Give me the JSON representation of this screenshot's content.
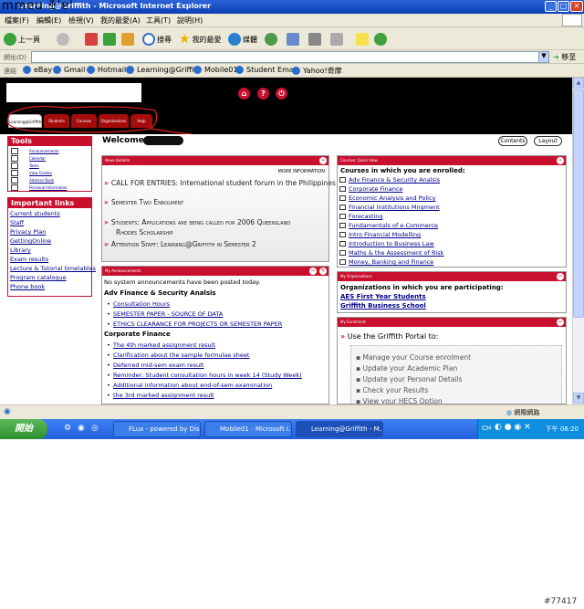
{
  "window": {
    "title": "Learning@Griffith - Microsoft Internet Explorer",
    "title_overwrite": "mmeu ꔀ'ɐ'"
  },
  "menu": [
    "檔案(F)",
    "編輯(E)",
    "檢視(V)",
    "我的最愛(A)",
    "工具(T)",
    "說明(H)"
  ],
  "toolbar": {
    "back": "上一頁",
    "search": "搜尋",
    "favorites": "我的最愛",
    "media": "媒體"
  },
  "address": {
    "label": "網址(D)",
    "value": "",
    "go": "移至"
  },
  "links": {
    "label": "連結",
    "items": [
      "eBay",
      "Gmail",
      "Hotmail",
      "Learning@Griffith",
      "Mobile01",
      "Student Email",
      "Yahoo!奇摩"
    ]
  },
  "site": {
    "nav_tabs": [
      "Learning@Griffith",
      "Students",
      "Courses",
      "Organisations",
      "Help"
    ],
    "tools": {
      "title": "Tools",
      "items": [
        "Announcements",
        "Calendar",
        "Tasks",
        "View Grades",
        "Address Book",
        "Personal Information"
      ]
    },
    "important": {
      "title": "Important links",
      "items": [
        "Current students",
        "Staff",
        "Privacy Plan",
        "GettingOnline",
        "Library",
        "Exam results",
        "Lecture & Tutorial timetables",
        "Program catalogue",
        "Phone book"
      ]
    },
    "welcome": "Welcome,",
    "contents_btn": "Contents",
    "layout_btn": "Layout",
    "news": {
      "title": "News Bulletin",
      "more": "MORE INFORMATION",
      "items": [
        "CALL FOR ENTRIES: International student forum in the Philippines",
        "Semester Two Enrolment",
        "Students: Applications are being called for 2006 Queensland",
        "Rhodes Scholarship",
        "Attention Staff: Learning@Griffith in Semester 2"
      ]
    },
    "announcements": {
      "title": "My Announcements",
      "none_text": "No system announcements have been posted today.",
      "sections": [
        {
          "name": "Adv Finance & Security Analsis",
          "items": [
            "Consultation Hours",
            "SEMESTER PAPER - SOURCE OF DATA",
            "ETHICS CLEARANCE FOR PROJECTS OR SEMESTER PAPER"
          ]
        },
        {
          "name": "Corporate Finance",
          "items": [
            "The 4th marked assignment result",
            "Clarification about the sample formulae sheet",
            "Deferred mid-sem exam result",
            "Reminder: Student consultation hours in week 14 (Study Week)",
            "Additional information about end-of-sem examination",
            "the 3rd marked assignment result"
          ]
        }
      ]
    },
    "quickview": {
      "title": "Courses: Quick View",
      "heading": "Courses in which you are enrolled:",
      "courses": [
        "Adv Finance & Security Analsis",
        "Corporate Finance",
        "Economic Analysis and Policy",
        "Financial Institutions Mngment",
        "Forecasting",
        "Fundamentals of e-Commerce",
        "Intro Financial Modelling",
        "Introduction to Business Law",
        "Maths & the Assessment of Risk",
        "Money, Banking and Finance"
      ]
    },
    "organisations": {
      "title": "My Organisations",
      "heading": "Organizations in which you are participating:",
      "items": [
        "AES First Year Students",
        "Griffith Business School"
      ]
    },
    "enrolment": {
      "title": "My Enrolment",
      "intro": "Use the Griffith Portal to:",
      "items": [
        "Manage your Course enrolment",
        "Update your Academic Plan",
        "Update your Personal Details",
        "Check your Results",
        "View your HECS Option"
      ]
    }
  },
  "statusbar": {
    "zone": "網際網路"
  },
  "taskbar": {
    "start": "開始",
    "tasks": [
      "FLux - powered by Dis...",
      "Mobile01 - Microsoft I...",
      "Learning@Griffith - M..."
    ],
    "lang": "CH",
    "clock": "下午 08:20"
  },
  "watermark": "#77417",
  "colors": {
    "brand_red": "#c8102e",
    "xp_blue": "#245edb"
  }
}
